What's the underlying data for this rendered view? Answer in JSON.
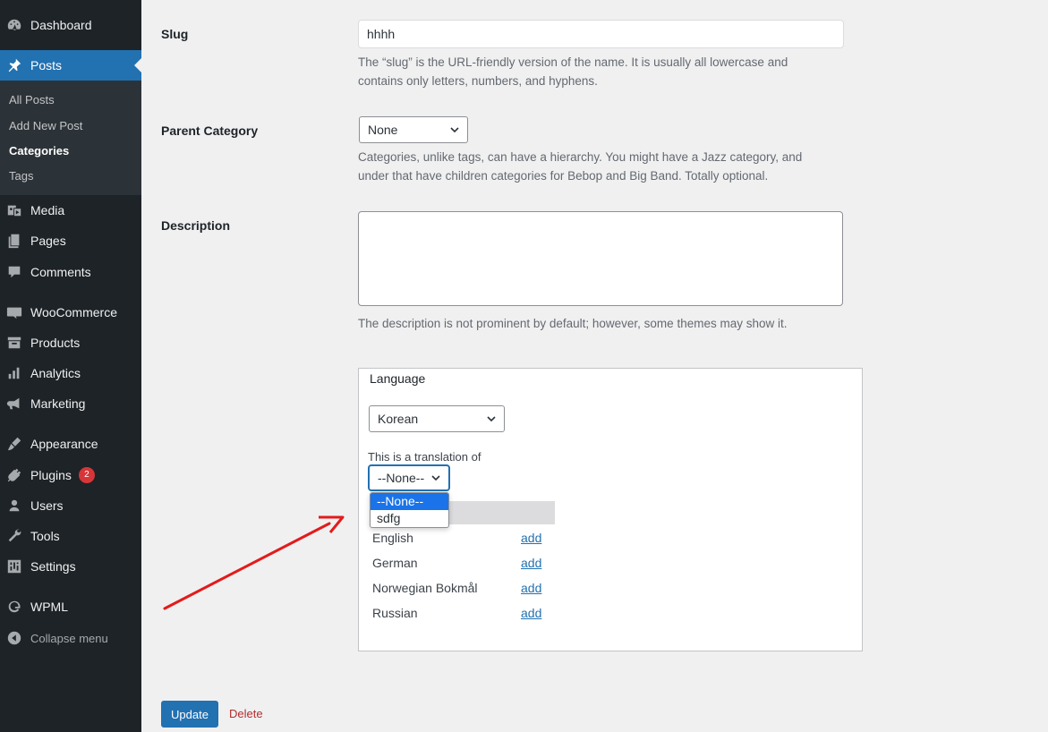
{
  "sidebar": {
    "items": [
      {
        "label": "Dashboard",
        "icon": "dashboard-icon"
      },
      {
        "label": "Posts",
        "icon": "pin-icon"
      },
      {
        "label": "Media",
        "icon": "media-icon"
      },
      {
        "label": "Pages",
        "icon": "pages-icon"
      },
      {
        "label": "Comments",
        "icon": "comments-icon"
      },
      {
        "label": "WooCommerce",
        "icon": "woocommerce-icon"
      },
      {
        "label": "Products",
        "icon": "products-icon"
      },
      {
        "label": "Analytics",
        "icon": "analytics-icon"
      },
      {
        "label": "Marketing",
        "icon": "megaphone-icon"
      },
      {
        "label": "Appearance",
        "icon": "brush-icon"
      },
      {
        "label": "Plugins",
        "icon": "plug-icon",
        "badge": "2"
      },
      {
        "label": "Users",
        "icon": "users-icon"
      },
      {
        "label": "Tools",
        "icon": "wrench-icon"
      },
      {
        "label": "Settings",
        "icon": "settings-icon"
      },
      {
        "label": "WPML",
        "icon": "wpml-icon"
      }
    ],
    "submenu": [
      "All Posts",
      "Add New Post",
      "Categories",
      "Tags"
    ],
    "collapse_label": "Collapse menu"
  },
  "form": {
    "slug": {
      "label": "Slug",
      "value": "hhhh",
      "help_1": "The “slug” is the URL-friendly version of the name. It is usually all lowercase and",
      "help_2": "contains only letters, numbers, and hyphens."
    },
    "parent": {
      "label": "Parent Category",
      "value": "None",
      "help_1": "Categories, unlike tags, can have a hierarchy. You might have a Jazz category, and",
      "help_2": "under that have children categories for Bebop and Big Band. Totally optional."
    },
    "description": {
      "label": "Description",
      "value": "",
      "help": "The description is not prominent by default; however, some themes may show it."
    }
  },
  "language_box": {
    "title": "Language",
    "language_value": "Korean",
    "translation_label": "This is a translation of",
    "translation_value": "--None--",
    "dropdown_options": [
      "--None--",
      "sdfg"
    ],
    "languages": [
      {
        "name": "English",
        "action": "add"
      },
      {
        "name": "German",
        "action": "add"
      },
      {
        "name": "Norwegian Bokmål",
        "action": "add"
      },
      {
        "name": "Russian",
        "action": "add"
      }
    ]
  },
  "actions": {
    "update_label": "Update",
    "delete_label": "Delete"
  },
  "colors": {
    "sidebar_bg": "#1d2327",
    "accent": "#2271b1",
    "delete": "#b32d2e",
    "annotation_arrow": "#e31b1b"
  }
}
